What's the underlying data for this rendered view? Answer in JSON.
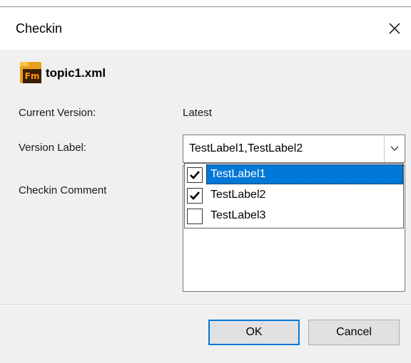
{
  "window": {
    "title": "Checkin"
  },
  "file": {
    "icon_text": "Fm",
    "name": "topic1.xml"
  },
  "form": {
    "current_version_label": "Current Version:",
    "current_version_value": "Latest",
    "version_label_label": "Version Label:",
    "version_label_value": "TestLabel1,TestLabel2",
    "checkin_comment_label": "Checkin Comment",
    "checkin_comment_value": ""
  },
  "dropdown": {
    "options": [
      {
        "label": "TestLabel1",
        "checked": true,
        "selected": true
      },
      {
        "label": "TestLabel2",
        "checked": true,
        "selected": false
      },
      {
        "label": "TestLabel3",
        "checked": false,
        "selected": false
      }
    ]
  },
  "buttons": {
    "ok_label": "OK",
    "cancel_label": "Cancel"
  },
  "colors": {
    "selection": "#0078d7",
    "dialog_bg": "#f0f0f0",
    "icon_orange": "#e8a01a"
  }
}
